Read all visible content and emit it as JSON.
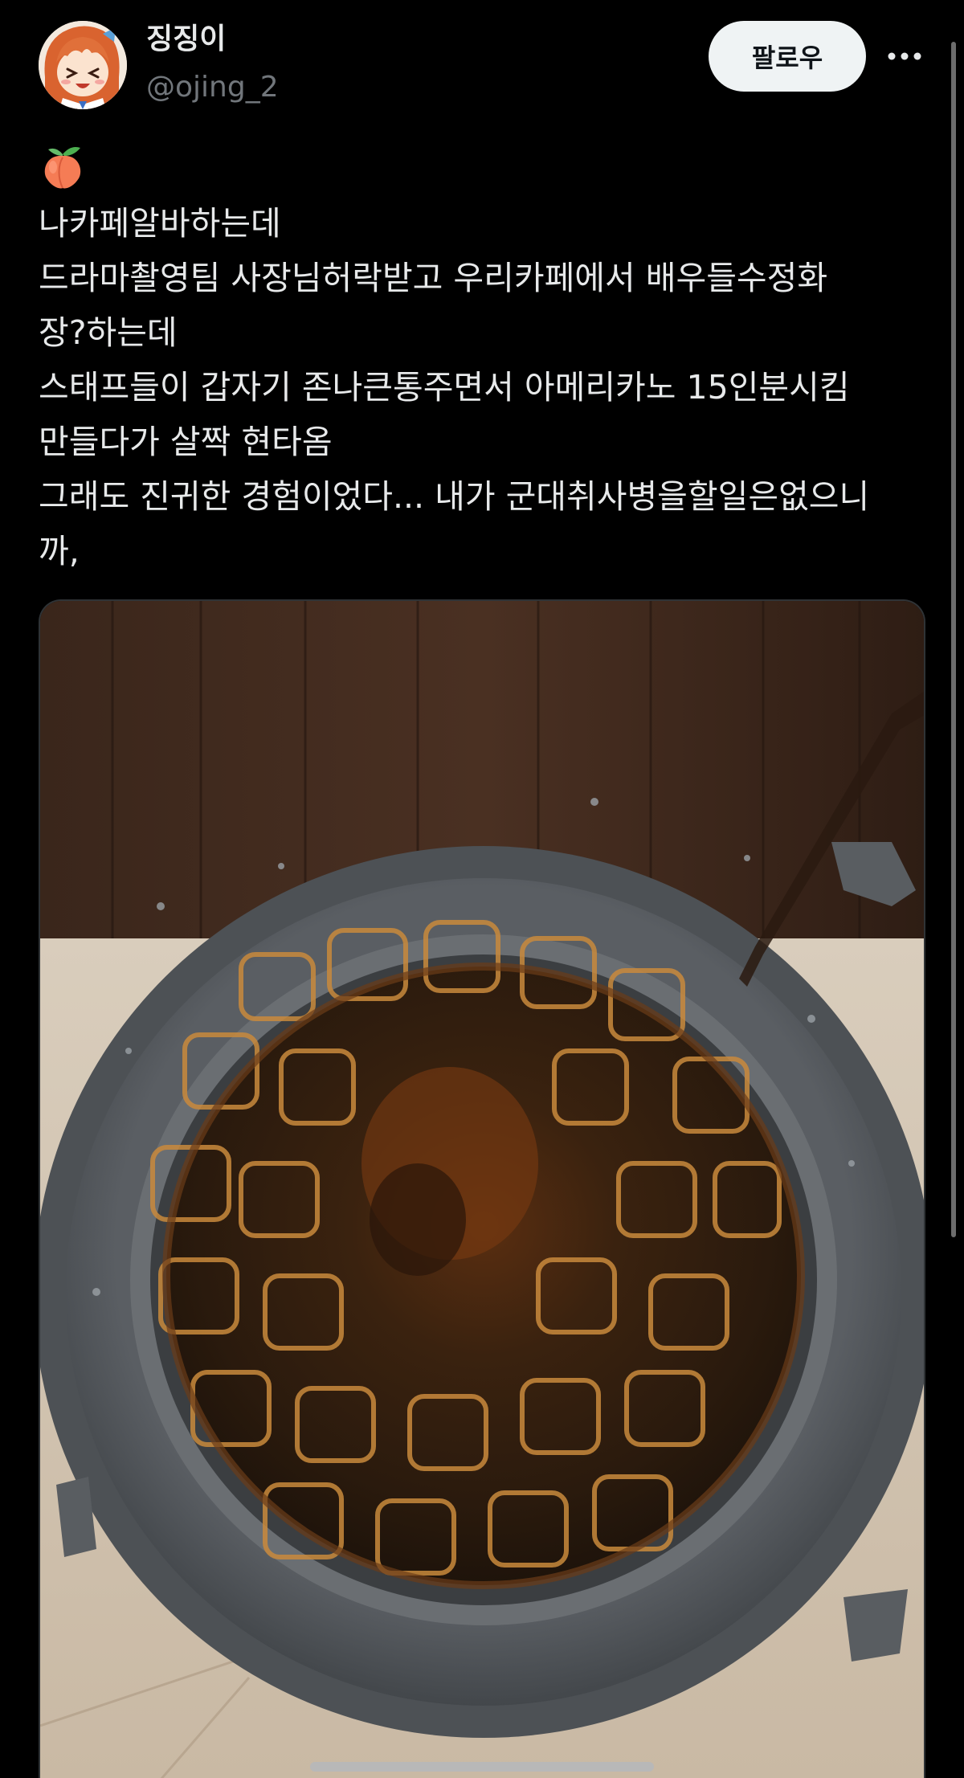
{
  "user": {
    "display_name": "징징이",
    "handle": "@ojing_2",
    "avatar_icon": "anime-girl-avatar"
  },
  "actions": {
    "follow_label": "팔로우",
    "more_icon": "more-horizontal-icon"
  },
  "tweet": {
    "emoji_icon": "peach-icon",
    "lines": [
      "나카페알바하는데",
      "드라마촬영팀 사장님허락받고 우리카페에서 배우들수정화",
      "장?하는데",
      "스태프들이 갑자기 존나큰통주면서 아메리카노 15인분시킴",
      "만들다가 살짝 현타옴",
      "그래도 진귀한 경험이었다... 내가 군대취사병을할일은없으니",
      "까,"
    ]
  },
  "media": {
    "description_icon": "iced-americano-bucket-photo"
  },
  "colors": {
    "background": "#000000",
    "text_primary": "#e7e9ea",
    "text_secondary": "#71767b",
    "follow_bg": "#eff3f4"
  }
}
